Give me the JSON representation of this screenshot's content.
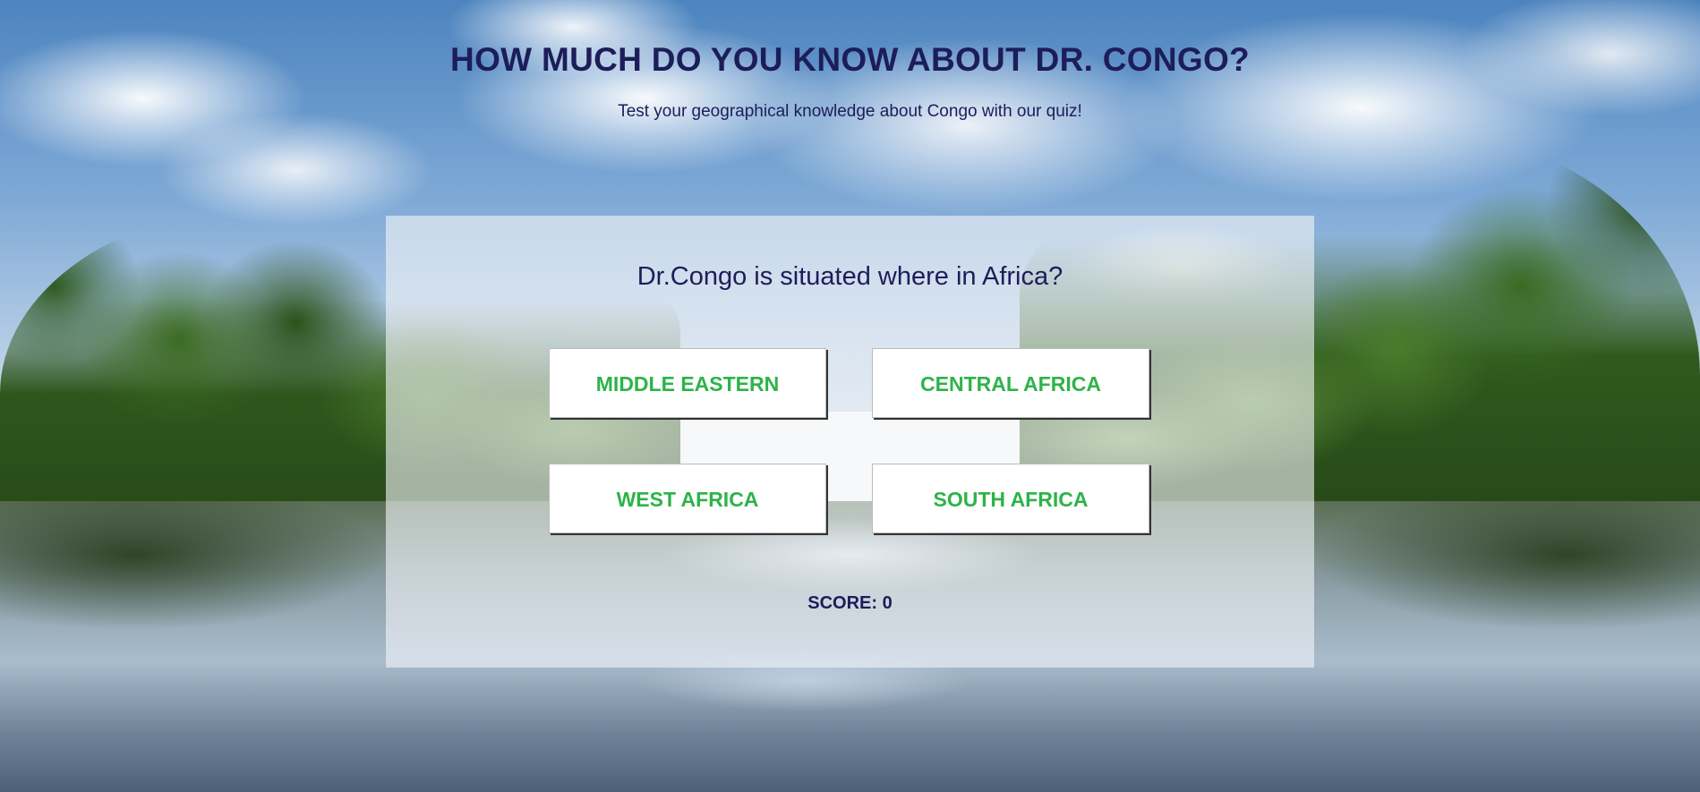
{
  "header": {
    "title": "HOW MUCH DO YOU KNOW ABOUT DR. CONGO?",
    "subtitle": "Test your geographical knowledge about Congo with our quiz!"
  },
  "quiz": {
    "question": "Dr.Congo is situated where in Africa?",
    "answers": [
      "MIDDLE EASTERN",
      "CENTRAL AFRICA",
      "WEST AFRICA",
      "SOUTH AFRICA"
    ],
    "score_label": "SCORE:",
    "score_value": "0"
  },
  "colors": {
    "title": "#1d1d5a",
    "answer_text": "#2eb34a",
    "button_bg": "#ffffff"
  }
}
